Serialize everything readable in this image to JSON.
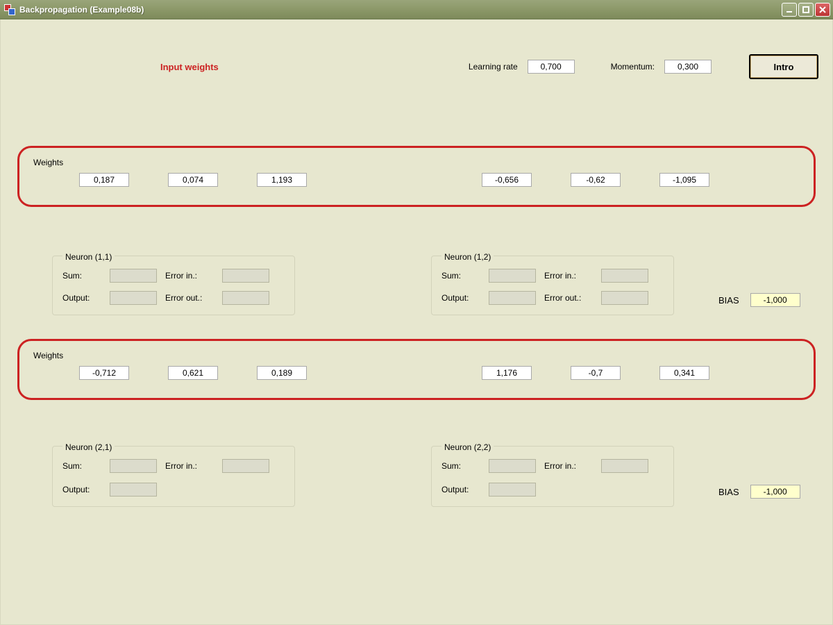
{
  "window": {
    "title": "Backpropagation (Example08b)"
  },
  "header": {
    "input_weights": "Input weights",
    "learning_rate_label": "Learning rate",
    "learning_rate_value": "0,700",
    "momentum_label": "Momentum:",
    "momentum_value": "0,300",
    "intro_button": "Intro"
  },
  "weights1": {
    "title": "Weights",
    "values": [
      "0,187",
      "0,074",
      "1,193",
      "-0,656",
      "-0,62",
      "-1,095"
    ]
  },
  "weights2": {
    "title": "Weights",
    "values": [
      "-0,712",
      "0,621",
      "0,189",
      "1,176",
      "-0,7",
      "0,341"
    ]
  },
  "neurons": {
    "n11": {
      "legend": "Neuron (1,1)",
      "sum": "Sum:",
      "output": "Output:",
      "errin": "Error in.:",
      "errout": "Error out.:"
    },
    "n12": {
      "legend": "Neuron (1,2)",
      "sum": "Sum:",
      "output": "Output:",
      "errin": "Error in.:",
      "errout": "Error out.:"
    },
    "n21": {
      "legend": "Neuron (2,1)",
      "sum": "Sum:",
      "output": "Output:",
      "errin": "Error in.:"
    },
    "n22": {
      "legend": "Neuron (2,2)",
      "sum": "Sum:",
      "output": "Output:",
      "errin": "Error in.:"
    }
  },
  "bias": {
    "label": "BIAS",
    "value1": "-1,000",
    "value2": "-1,000"
  }
}
